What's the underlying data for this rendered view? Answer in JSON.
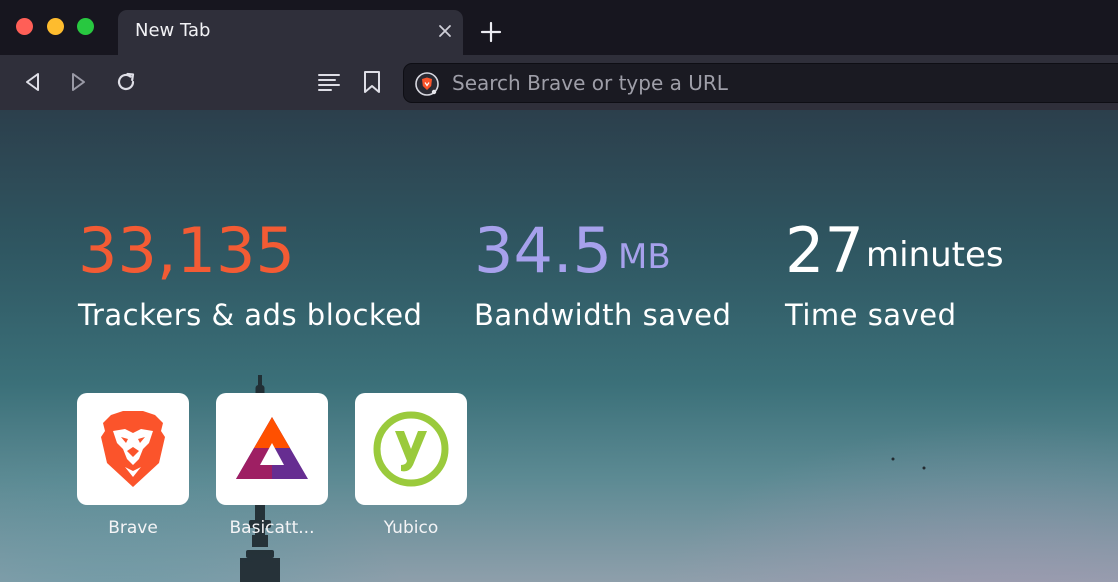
{
  "tab": {
    "title": "New Tab"
  },
  "toolbar": {
    "search_placeholder": "Search Brave or type a URL"
  },
  "stats": [
    {
      "value": "33,135",
      "unit": "",
      "label": "Trackers & ads blocked",
      "color": "#f35b34"
    },
    {
      "value": "34.5",
      "unit": "MB",
      "label": "Bandwidth saved",
      "color": "#a7a1ec"
    },
    {
      "value": "27",
      "unit": "minutes",
      "label": "Time saved",
      "color": "#ffffff"
    }
  ],
  "top_sites": [
    {
      "label": "Brave",
      "icon": "brave-lion-icon"
    },
    {
      "label": "Basicatt...",
      "icon": "bat-triangle-icon"
    },
    {
      "label": "Yubico",
      "icon": "yubico-icon"
    }
  ],
  "colors": {
    "window_bg": "#17161f",
    "toolbar_bg": "#2f2f3a",
    "brave_orange": "#fb542b",
    "bat_purple": "#662d91",
    "yubico_green": "#9aca3c"
  }
}
